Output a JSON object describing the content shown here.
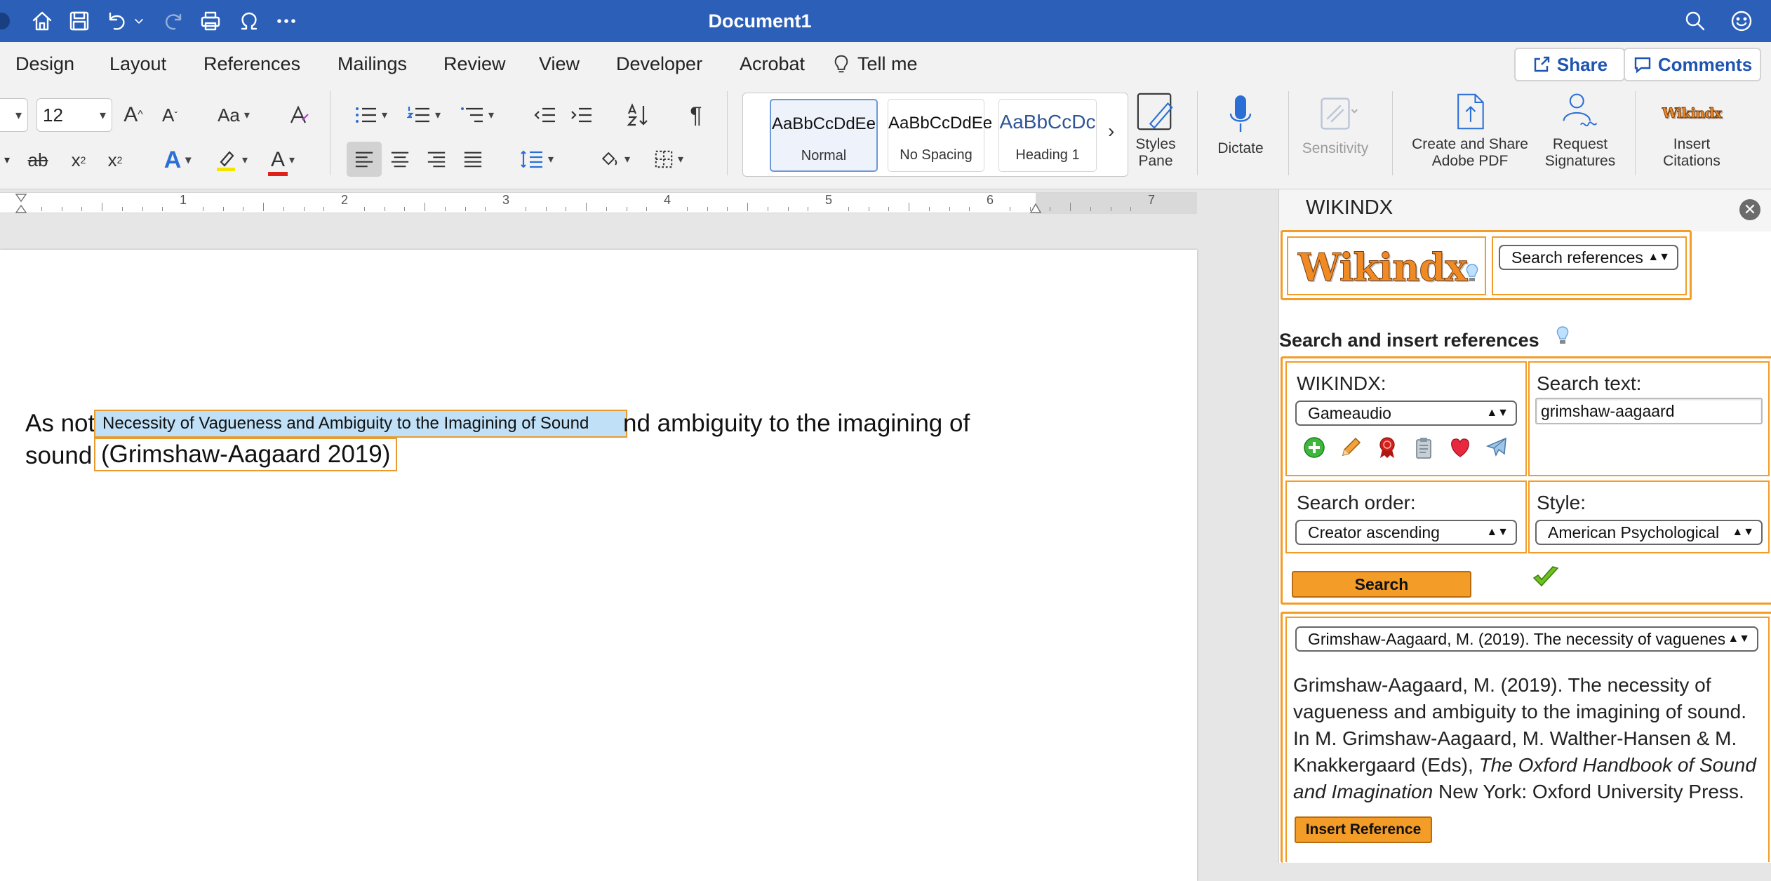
{
  "titlebar": {
    "title": "Document1",
    "quick_access": [
      "home-icon",
      "save-icon",
      "undo-icon",
      "redo-icon",
      "print-icon",
      "omega-icon",
      "more-icon"
    ]
  },
  "menu": {
    "tabs": [
      "Design",
      "Layout",
      "References",
      "Mailings",
      "Review",
      "View",
      "Developer",
      "Acrobat"
    ],
    "tell_me": "Tell me",
    "share": "Share",
    "comments": "Comments"
  },
  "ribbon": {
    "font_size": "12",
    "styles": [
      {
        "preview": "AaBbCcDdEe",
        "name": "Normal"
      },
      {
        "preview": "AaBbCcDdEe",
        "name": "No Spacing"
      },
      {
        "preview": "AaBbCcDc",
        "name": "Heading 1"
      }
    ],
    "styles_pane": "Styles\nPane",
    "dictate": "Dictate",
    "sensitivity": "Sensitivity",
    "create_share_pdf": "Create and Share\nAdobe PDF",
    "request_signatures": "Request\nSignatures",
    "insert_citations": "Insert\nCitations",
    "accent_colors": {
      "highlight": "#f5e400",
      "font_color": "#e0201b",
      "text_effects": "#2a6fd6"
    }
  },
  "ruler": {
    "numbers": [
      "1",
      "2",
      "3",
      "4",
      "5",
      "6",
      "7"
    ]
  },
  "document": {
    "line1_start": "As not",
    "content_control_title": "Necessity of Vagueness and Ambiguity to the Imagining of Sound",
    "line1_end": "nd ambiguity to the imagining of",
    "line2_start": "sound",
    "citation": "(Grimshaw-Aagaard 2019)"
  },
  "pane": {
    "title": "WIKINDX",
    "logo_text": "Wikindx",
    "mode_select": "Search references",
    "section_title": "Search and insert references",
    "wikindx_label": "WIKINDX:",
    "wikindx_value": "Gameaudio",
    "search_text_label": "Search text:",
    "search_text_value": "grimshaw-aagaard",
    "search_order_label": "Search order:",
    "search_order_value": "Creator ascending",
    "style_label": "Style:",
    "style_value": "American Psychological",
    "search_button": "Search",
    "result_select": "Grimshaw-Aagaard, M. (2019). The necessity of vagueness",
    "reference": {
      "part1": "Grimshaw-Aagaard, M. (2019). The necessity of vagueness and ambiguity to the imagining of sound. In M. Grimshaw-Aagaard, M. Walther-Hansen & M. Knakkergaard (Eds), ",
      "title": "The Oxford Handbook of Sound and Imagination",
      "part2": " New York: Oxford University Press."
    },
    "insert_button": "Insert Reference",
    "accent_color": "#f39c27"
  }
}
